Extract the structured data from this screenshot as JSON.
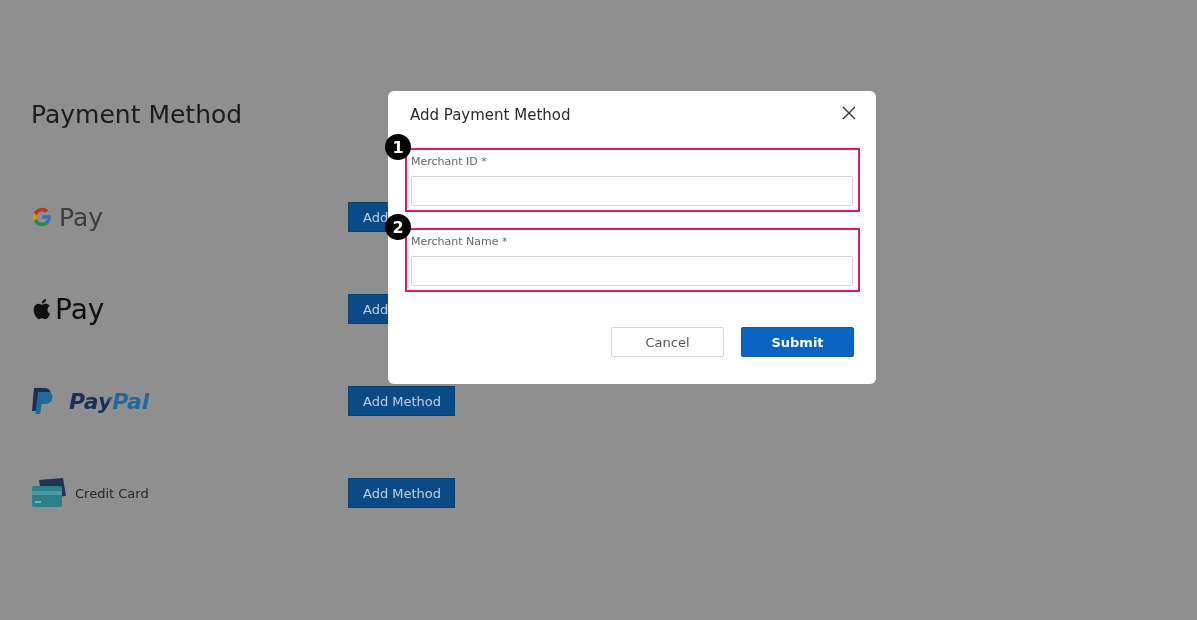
{
  "page": {
    "title": "Payment Method",
    "methods": [
      {
        "kind": "google_pay",
        "name": "Pay",
        "button": "Add"
      },
      {
        "kind": "apple_pay",
        "name": "Pay",
        "button": "Add"
      },
      {
        "kind": "paypal",
        "name": "PayPal",
        "button": "Add Method"
      },
      {
        "kind": "card",
        "name": "Credit Card",
        "button": "Add Method"
      }
    ]
  },
  "dialog": {
    "title": "Add Payment Method",
    "fields": [
      {
        "label": "Merchant ID *",
        "marker": "1"
      },
      {
        "label": "Merchant Name *",
        "marker": "2"
      }
    ],
    "buttons": [
      {
        "label": "Cancel",
        "kind": "secondary"
      },
      {
        "label": "Submit",
        "kind": "primary"
      }
    ]
  }
}
